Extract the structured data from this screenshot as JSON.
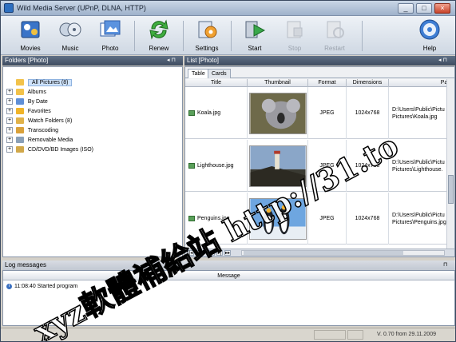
{
  "window": {
    "title": "Wild Media Server (UPnP, DLNA, HTTP)",
    "min_label": "_",
    "max_label": "□",
    "close_label": "×"
  },
  "toolbar": {
    "movies": "Movies",
    "music": "Music",
    "photo": "Photo",
    "renew": "Renew",
    "settings": "Settings",
    "start": "Start",
    "stop": "Stop",
    "restart": "Restart",
    "help": "Help"
  },
  "folders_pane": {
    "header": "Folders [Photo]",
    "pin": "◂ ⊓",
    "items": [
      {
        "label": "All Pictures (8)",
        "expander": "",
        "color": "#f2c24a"
      },
      {
        "label": "Albums",
        "expander": "+",
        "color": "#f2c24a"
      },
      {
        "label": "By Date",
        "expander": "+",
        "color": "#5f8fd6"
      },
      {
        "label": "Favorites",
        "expander": "+",
        "color": "#f0b429"
      },
      {
        "label": "Watch Folders (8)",
        "expander": "+",
        "color": "#e0b24a"
      },
      {
        "label": "Transcoding",
        "expander": "+",
        "color": "#d9a13b"
      },
      {
        "label": "Removable Media",
        "expander": "+",
        "color": "#8aa0b8"
      },
      {
        "label": "CD/DVD/BD Images (ISO)",
        "expander": "+",
        "color": "#d1a84a"
      }
    ]
  },
  "list_pane": {
    "header": "List [Photo]",
    "pin": "◂ ⊓",
    "tabs": [
      "Table",
      "Cards"
    ],
    "columns": [
      "Title",
      "Thumbnail",
      "Format",
      "Dimensions",
      "Path"
    ],
    "rows": [
      {
        "title": "Koala.jpg",
        "format": "JPEG",
        "dimensions": "1024x768",
        "path_line1": "D:\\Users\\Public\\Pictu",
        "path_line2": "Pictures\\Koala.jpg"
      },
      {
        "title": "Lighthouse.jpg",
        "format": "JPEG",
        "dimensions": "1024x768",
        "path_line1": "D:\\Users\\Public\\Pictu",
        "path_line2": "Pictures\\Lighthouse."
      },
      {
        "title": "Penguins.jpg",
        "format": "JPEG",
        "dimensions": "1024x768",
        "path_line1": "D:\\Users\\Public\\Pictu",
        "path_line2": "Pictures\\Penguins.jpg"
      }
    ],
    "nav": {
      "first": "|◂",
      "prev": "◂",
      "next": "▸",
      "last": "▸|",
      "more": "▸▸"
    }
  },
  "log": {
    "header": "Log messages",
    "pin": "⊓",
    "column": "Message",
    "lines": [
      {
        "text": "11:08:40 Started program"
      }
    ]
  },
  "statusbar": {
    "version": "V. 0.70 from 29.11.2009"
  },
  "watermark": "xyz軟體補給站 http://31.to",
  "colors": {
    "accent": "#3e4c60",
    "selection": "#cfe3fb"
  }
}
